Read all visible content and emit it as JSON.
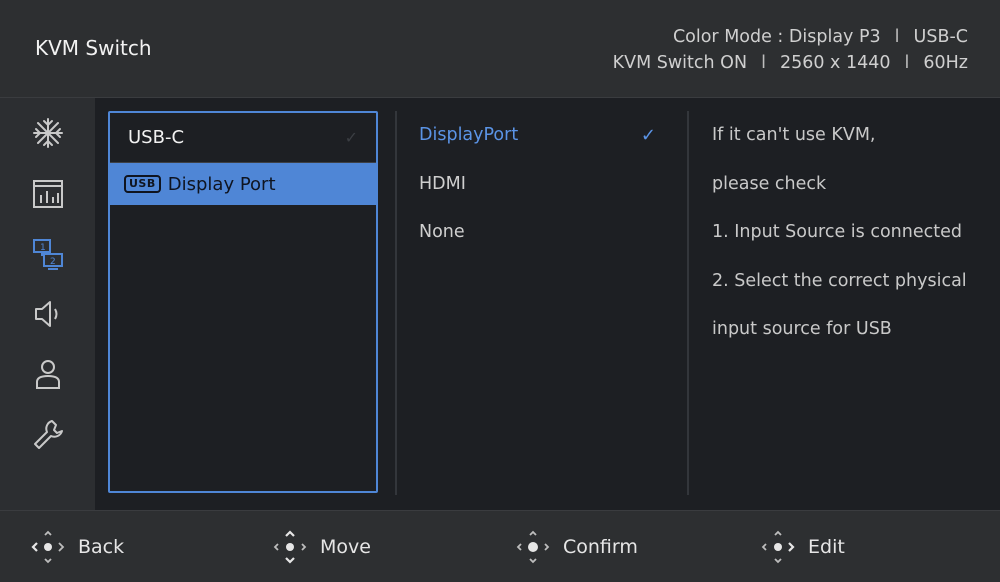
{
  "header": {
    "title": "KVM Switch",
    "color_mode": "Color Mode : Display P3",
    "input": "USB-C",
    "kvm_state": "KVM Switch ON",
    "resolution": "2560 x 1440",
    "refresh": "60Hz",
    "separator": "l"
  },
  "sidebar": {
    "items": [
      {
        "icon": "snowflake-icon",
        "label": ""
      },
      {
        "icon": "chart-icon"
      },
      {
        "icon": "display-switch-icon",
        "active": true
      },
      {
        "icon": "speaker-icon"
      },
      {
        "icon": "user-icon"
      },
      {
        "icon": "wrench-icon"
      }
    ]
  },
  "column1": {
    "header_label": "USB-C",
    "header_check": "✓",
    "selected_badge": "USB",
    "selected_label": "Display Port"
  },
  "column2": {
    "options": [
      "DisplayPort",
      "HDMI",
      "None"
    ],
    "active_check": "✓"
  },
  "column3": {
    "lines": [
      "If it can't use KVM,",
      "please check",
      "1. Input Source is connected",
      "2. Select the correct physical",
      "input source for USB"
    ]
  },
  "footer": {
    "back": "Back",
    "move": "Move",
    "confirm": "Confirm",
    "edit": "Edit"
  },
  "colors": {
    "accent": "#4f86d6",
    "accent_text": "#5b94e6",
    "panel": "#1d1f23",
    "chrome": "#2d2f31"
  }
}
